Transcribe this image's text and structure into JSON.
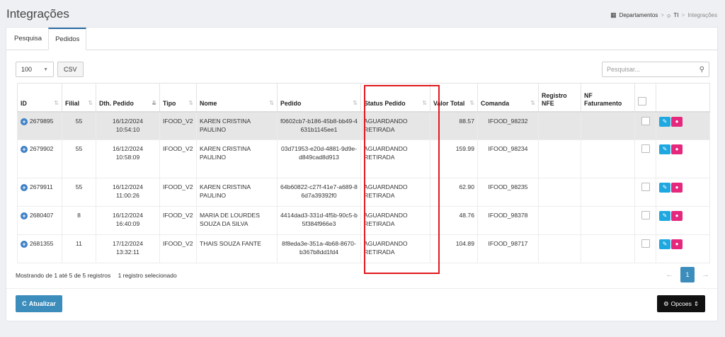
{
  "page_title": "Integrações",
  "breadcrumb": {
    "items": [
      "Departamentos",
      "TI",
      "Integrações"
    ]
  },
  "tabs": [
    {
      "label": "Pesquisa"
    },
    {
      "label": "Pedidos"
    }
  ],
  "toolbar": {
    "page_size": "100",
    "csv_label": "CSV",
    "search_placeholder": "Pesquisar..."
  },
  "table": {
    "columns": [
      "ID",
      "Filial",
      "Dth. Pedido",
      "Tipo",
      "Nome",
      "Pedido",
      "Status Pedido",
      "Valor Total",
      "Comanda",
      "Registro NFE",
      "NF Faturamento"
    ],
    "rows": [
      {
        "id": "2679895",
        "filial": "55",
        "data": "16/12/2024",
        "hora": "10:54:10",
        "tipo": "IFOOD_V2",
        "nome": "KAREN CRISTINA PAULINO",
        "pedido": "f0602cb7-b186-45b8-bb49-4631b1145ee1",
        "status": "AGUARDANDO RETIRADA",
        "valor": "88.57",
        "comanda": "IFOOD_98232",
        "registro": "",
        "nf": ""
      },
      {
        "id": "2679902",
        "filial": "55",
        "data": "16/12/2024",
        "hora": "10:58:09",
        "tipo": "IFOOD_V2",
        "nome": "KAREN CRISTINA PAULINO",
        "pedido": "03d71953-e20d-4881-9d9e-d849cad8d913",
        "status": "AGUARDANDO RETIRADA",
        "valor": "159.99",
        "comanda": "IFOOD_98234",
        "registro": "",
        "nf": ""
      },
      {
        "id": "2679911",
        "filial": "55",
        "data": "16/12/2024",
        "hora": "11:00:26",
        "tipo": "IFOOD_V2",
        "nome": "KAREN CRISTINA PAULINO",
        "pedido": "64b60822-c27f-41e7-a689-86d7a39392f0",
        "status": "AGUARDANDO RETIRADA",
        "valor": "62.90",
        "comanda": "IFOOD_98235",
        "registro": "",
        "nf": ""
      },
      {
        "id": "2680407",
        "filial": "8",
        "data": "16/12/2024",
        "hora": "16:40:09",
        "tipo": "IFOOD_V2",
        "nome": "MARIA DE LOURDES SOUZA DA SILVA",
        "pedido": "4414dad3-331d-4f5b-90c5-b5f384f966e3",
        "status": "AGUARDANDO RETIRADA",
        "valor": "48.76",
        "comanda": "IFOOD_98378",
        "registro": "",
        "nf": ""
      },
      {
        "id": "2681355",
        "filial": "11",
        "data": "17/12/2024",
        "hora": "13:32:11",
        "tipo": "IFOOD_V2",
        "nome": "THAIS SOUZA FANTE",
        "pedido": "8f8eda3e-351a-4b68-8670-b367b8dd1fd4",
        "status": "AGUARDANDO RETIRADA",
        "valor": "104.89",
        "comanda": "IFOOD_98717",
        "registro": "",
        "nf": ""
      }
    ]
  },
  "footer": {
    "info": "Mostrando de 1 até 5 de 5 registros",
    "selected": "1 registro selecionado",
    "current_page": "1",
    "atualizar_label": "Atualizar",
    "opcoes_label": "Opcoes"
  },
  "colors": {
    "primary": "#3c8dbc",
    "edit": "#1fa8e0",
    "message": "#e5287e",
    "highlight": "#e0191e",
    "dark_button": "#111111"
  }
}
